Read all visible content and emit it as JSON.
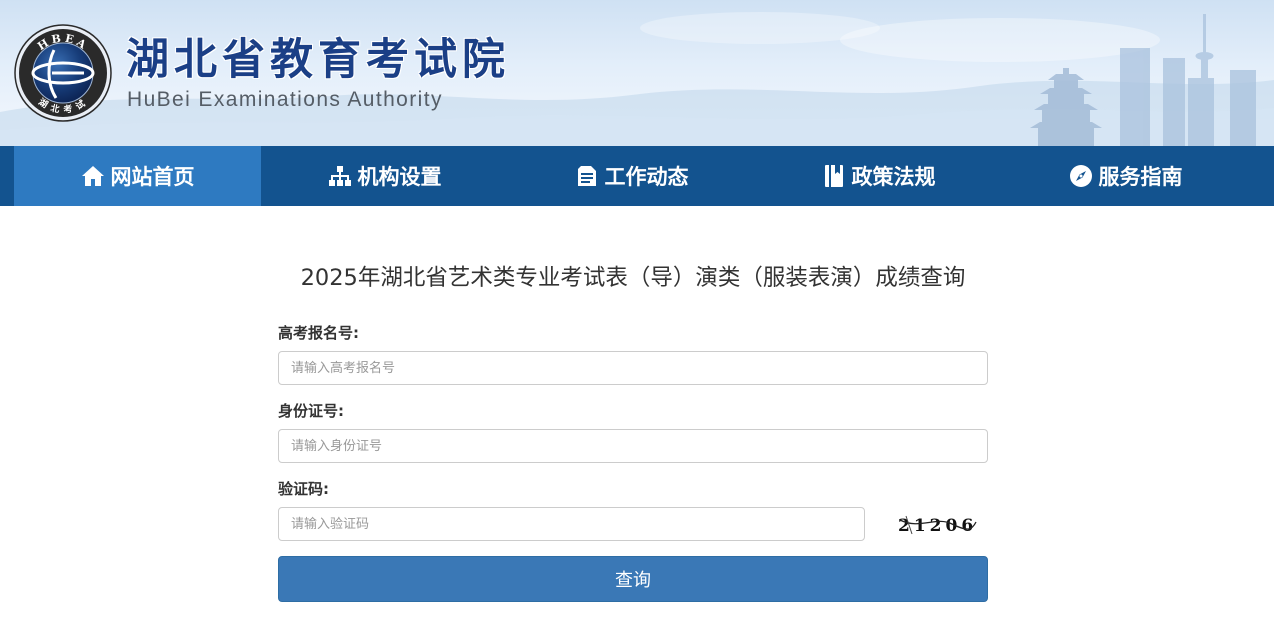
{
  "header": {
    "title": "湖北省教育考试院",
    "subtitle": "HuBei Examinations Authority",
    "emblem_top_text": "HBEA",
    "emblem_bottom_text": "湖北考试"
  },
  "nav": {
    "items": [
      {
        "label": "网站首页",
        "icon": "home-icon",
        "active": true
      },
      {
        "label": "机构设置",
        "icon": "sitemap-icon",
        "active": false
      },
      {
        "label": "工作动态",
        "icon": "document-icon",
        "active": false
      },
      {
        "label": "政策法规",
        "icon": "book-icon",
        "active": false
      },
      {
        "label": "服务指南",
        "icon": "compass-icon",
        "active": false
      }
    ]
  },
  "form": {
    "title": "2025年湖北省艺术类专业考试表（导）演类（服装表演）成绩查询",
    "exam_number": {
      "label": "高考报名号:",
      "placeholder": "请输入高考报名号",
      "value": ""
    },
    "id_number": {
      "label": "身份证号:",
      "placeholder": "请输入身份证号",
      "value": ""
    },
    "captcha": {
      "label": "验证码:",
      "placeholder": "请输入验证码",
      "value": "",
      "image_text": "21206"
    },
    "submit_label": "查询"
  },
  "colors": {
    "nav_bg": "#13538f",
    "nav_active": "#2e7ac1",
    "title_blue": "#1b3f86",
    "button": "#3a78b6"
  }
}
